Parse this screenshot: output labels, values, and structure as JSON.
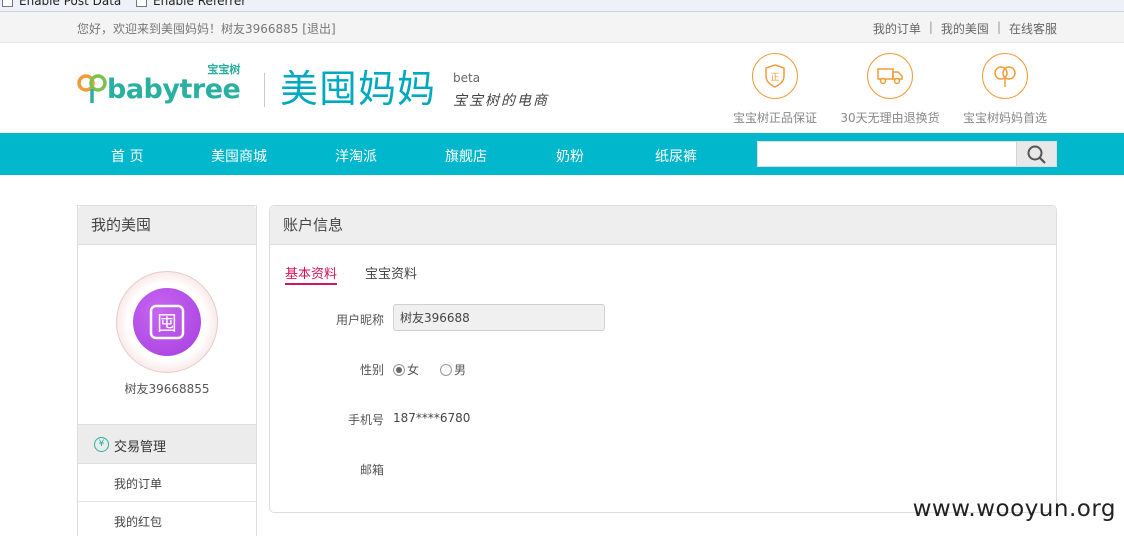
{
  "devbar": {
    "options": [
      "Enable Post Data",
      "Enable Referrer"
    ]
  },
  "topbar": {
    "welcome": "您好，欢迎来到美囤妈妈！树友3966885 [退出]",
    "links": [
      "我的订单",
      "我的美囤",
      "在线客服"
    ]
  },
  "header": {
    "logo_babytree": "babytree",
    "logo_babytree_cn": "宝宝树",
    "logo_meitun": "美囤妈妈",
    "beta": "beta",
    "slogan": "宝宝树的电商",
    "guarantees": [
      {
        "icon": "authentic-badge-icon",
        "glyph": "正",
        "label": "宝宝树正品保证"
      },
      {
        "icon": "delivery-truck-icon",
        "glyph": "",
        "label": "30天无理由退换货"
      },
      {
        "icon": "tree-icon",
        "glyph": "",
        "label": "宝宝树妈妈首选"
      }
    ]
  },
  "nav": {
    "items": [
      "首 页",
      "美囤商城",
      "洋淘派",
      "旗舰店",
      "奶粉",
      "纸尿裤"
    ],
    "search_value": ""
  },
  "sidebar": {
    "title": "我的美囤",
    "avatar_glyph": "囤",
    "username": "树友39668855",
    "section_title": "交易管理",
    "section_icon_glyph": "¥",
    "links": [
      "我的订单",
      "我的红包"
    ]
  },
  "account": {
    "title": "账户信息",
    "tabs": [
      "基本资料",
      "宝宝资料"
    ],
    "fields": {
      "nickname_label": "用户昵称",
      "nickname_value": "树友396688",
      "gender_label": "性别",
      "gender_options": [
        "女",
        "男"
      ],
      "gender_selected": "女",
      "phone_label": "手机号",
      "phone_value": "187****6780",
      "email_label": "邮箱"
    }
  },
  "watermark": "www.wooyun.org",
  "colors": {
    "nav_bg": "#00b7cb",
    "accent_tab": "#d4145a",
    "guarantee_orange": "#f29b3a",
    "avatar_purple": "#b04ce6"
  }
}
